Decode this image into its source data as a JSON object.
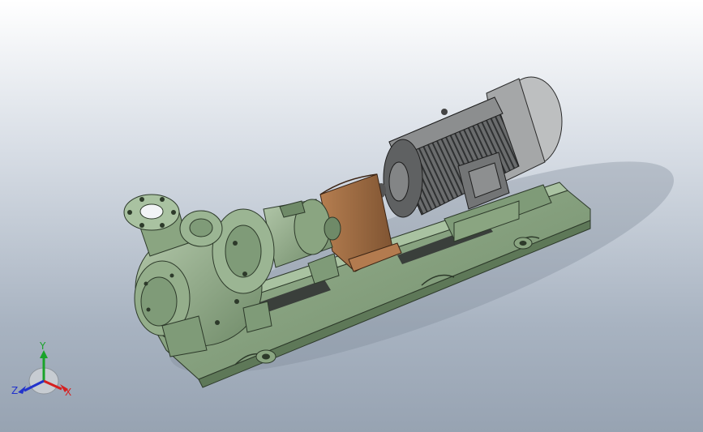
{
  "viewport": {
    "background_top": "#ffffff",
    "background_bottom": "#97a3b2"
  },
  "model": {
    "description_colors": {
      "pump_green": "#8faa86",
      "base_green": "#7f9b78",
      "coupling_guard": "#9a6a42",
      "motor_gray": "#7d7f80"
    }
  },
  "triad": {
    "y_label": "Y",
    "z_label": "Z",
    "x_label": "X",
    "colors": {
      "x": "#d62020",
      "y": "#1aa32a",
      "z": "#2233cc"
    }
  }
}
